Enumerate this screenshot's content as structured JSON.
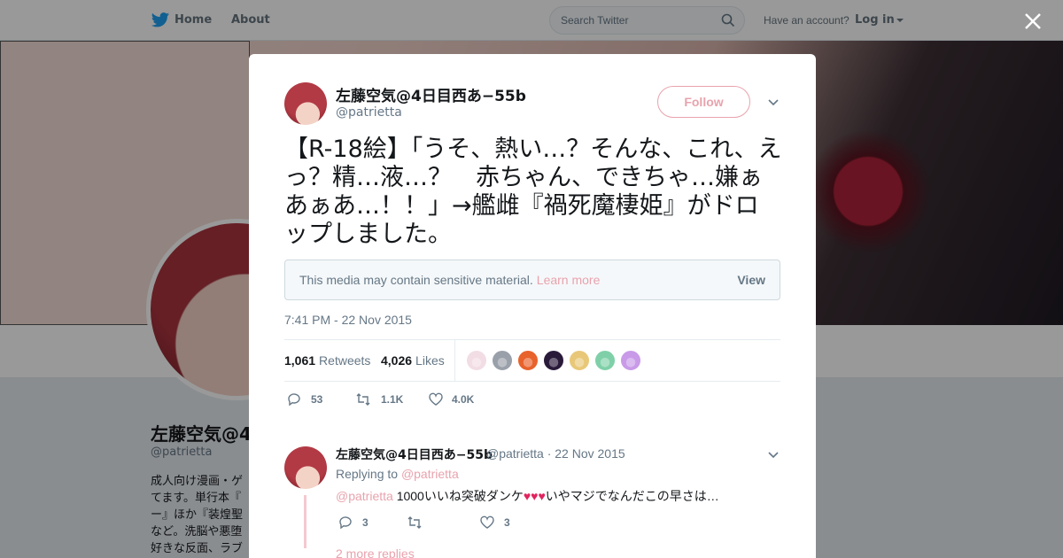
{
  "nav": {
    "home_label": "Home",
    "about_label": "About",
    "search_placeholder": "Search Twitter",
    "have_account": "Have an account?",
    "login_label": "Log in"
  },
  "background_profile": {
    "name": "左藤空気@4",
    "handle": "@patrietta",
    "bio": "成人向け漫画・ゲ てます。単行本『 ー』ほか『装煌聖 など。洗脳や悪堕 好きな反面、ラブ"
  },
  "tweet": {
    "author_name": "左藤空気@4日目西あ−55b",
    "author_handle": "@patrietta",
    "follow_label": "Follow",
    "text": "【R-18絵】「うそ、熱い…？そんな、これ、えっ？精…液…？　赤ちゃん、できちゃ…嫌ぁあぁあ…！！」→艦雌『禍死魔棲姫』がドロップしました。",
    "sensitive_notice": "This media may contain sensitive material.",
    "learn_more": "Learn more",
    "view_label": "View",
    "timestamp": "7:41 PM - 22 Nov 2015",
    "retweets_count": "1,061",
    "retweets_label": "Retweets",
    "likes_count": "4,026",
    "likes_label": "Likes",
    "reply_count": "53",
    "retweet_action_count": "1.1K",
    "like_action_count": "4.0K"
  },
  "liker_colors": [
    "#f2dde4",
    "#9aa0aa",
    "#e8622c",
    "#2a1a3a",
    "#e8c878",
    "#7fd0a8",
    "#c89ae8"
  ],
  "reply": {
    "author_name": "左藤空気@4日目西あ−55b",
    "author_handle": "@patrietta",
    "separator": "·",
    "date": "22 Nov 2015",
    "replying_to_label": "Replying to",
    "replying_to_handle": "@patrietta",
    "mention": "@patrietta",
    "text_before": "1000いいね突破ダンケ",
    "hearts": "♥♥♥",
    "text_after": "いやマジでなんだこの早さは…",
    "reply_count": "3",
    "like_count": "3",
    "more_replies": "2 more replies"
  }
}
